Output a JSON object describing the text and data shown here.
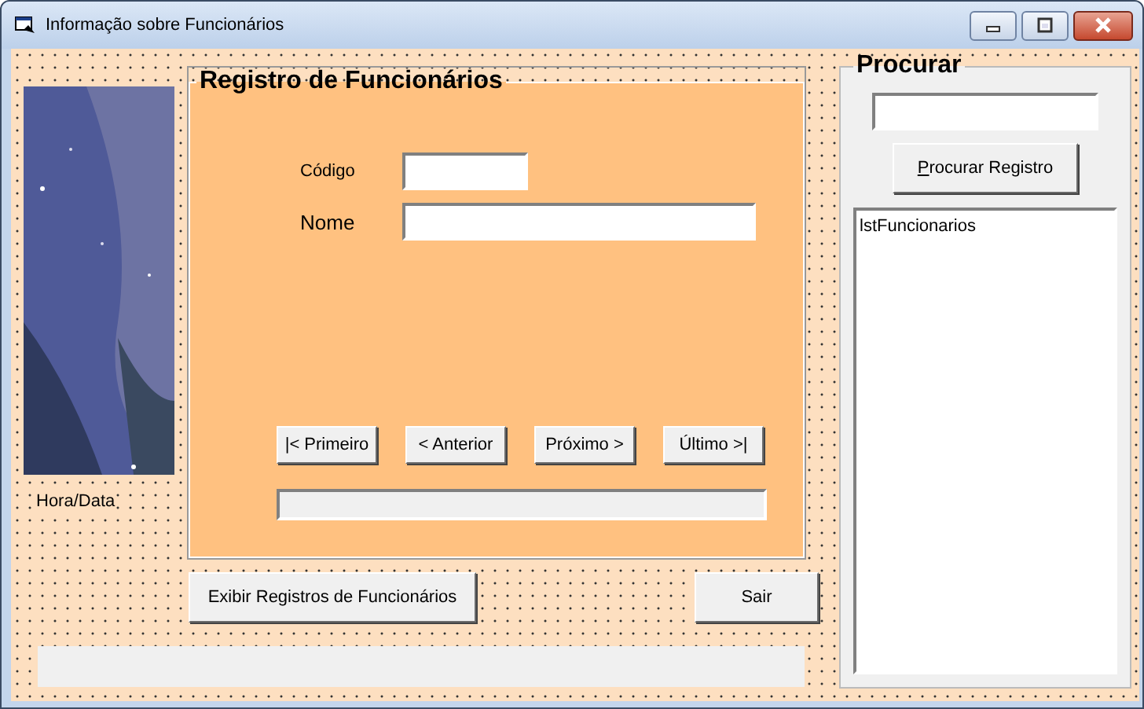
{
  "window": {
    "title": "Informação sobre Funcionários"
  },
  "clock_label": "Hora/Data",
  "record_frame": {
    "title": "Registro de Funcionários",
    "fields": [
      {
        "label": "Código"
      },
      {
        "label": "Nome"
      }
    ],
    "nav_buttons": [
      "|< Primeiro",
      "< Anterior",
      "Próximo >",
      "Último >|"
    ]
  },
  "buttons": [
    "Exibir Registros de Funcionários",
    "Sair"
  ],
  "search": {
    "title": "Procurar",
    "button": "Procurar Registro",
    "list_items": [
      "lstFuncionarios"
    ]
  }
}
